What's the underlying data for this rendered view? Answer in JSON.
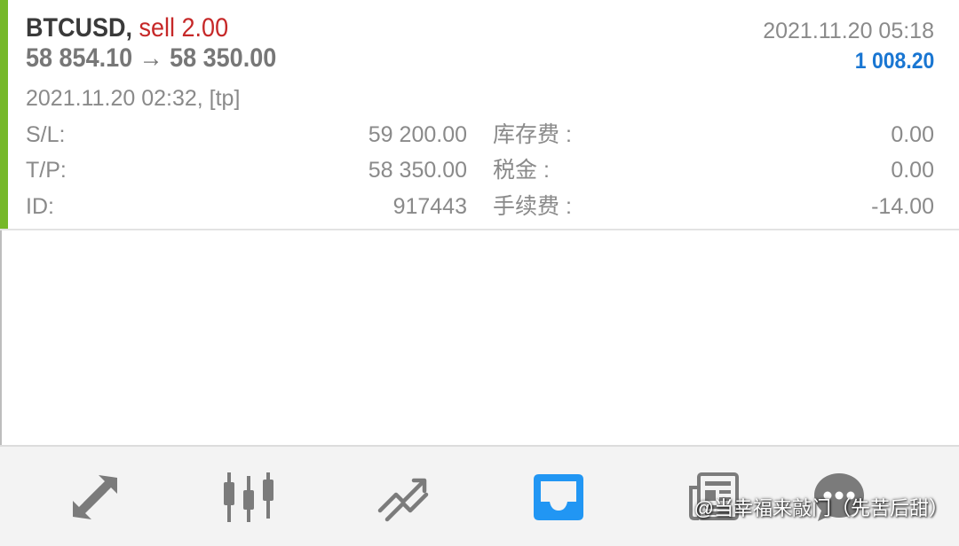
{
  "deal": {
    "symbol": "BTCUSD,",
    "side_volume": "sell 2.00",
    "price_change": "58 854.10 → 58 350.00",
    "close_time": "2021.11.20 05:18",
    "profit": "1 008.20",
    "open_info": "2021.11.20 02:32, [tp]",
    "details": {
      "sl_label": "S/L:",
      "sl_value": "59 200.00",
      "tp_label": "T/P:",
      "tp_value": "58 350.00",
      "id_label": "ID:",
      "id_value": "917443",
      "swap_label": "库存费 :",
      "swap_value": "0.00",
      "tax_label": "税金 :",
      "tax_value": "0.00",
      "commission_label": "手续费 :",
      "commission_value": "-14.00"
    }
  },
  "colors": {
    "accent_bar": "#76b82a",
    "sell": "#c62828",
    "profit": "#1976d2",
    "nav_icon": "#7b7b7b",
    "nav_active": "#2196f3"
  },
  "nav": {
    "items": [
      {
        "icon": "quotes-arrows-icon",
        "active": false
      },
      {
        "icon": "candlestick-chart-icon",
        "active": false
      },
      {
        "icon": "trade-icon",
        "active": false
      },
      {
        "icon": "history-inbox-icon",
        "active": true
      },
      {
        "icon": "news-icon",
        "active": false
      },
      {
        "icon": "chat-icon",
        "active": false
      }
    ]
  },
  "watermark": "@当幸福来敲门（先苦后甜）"
}
